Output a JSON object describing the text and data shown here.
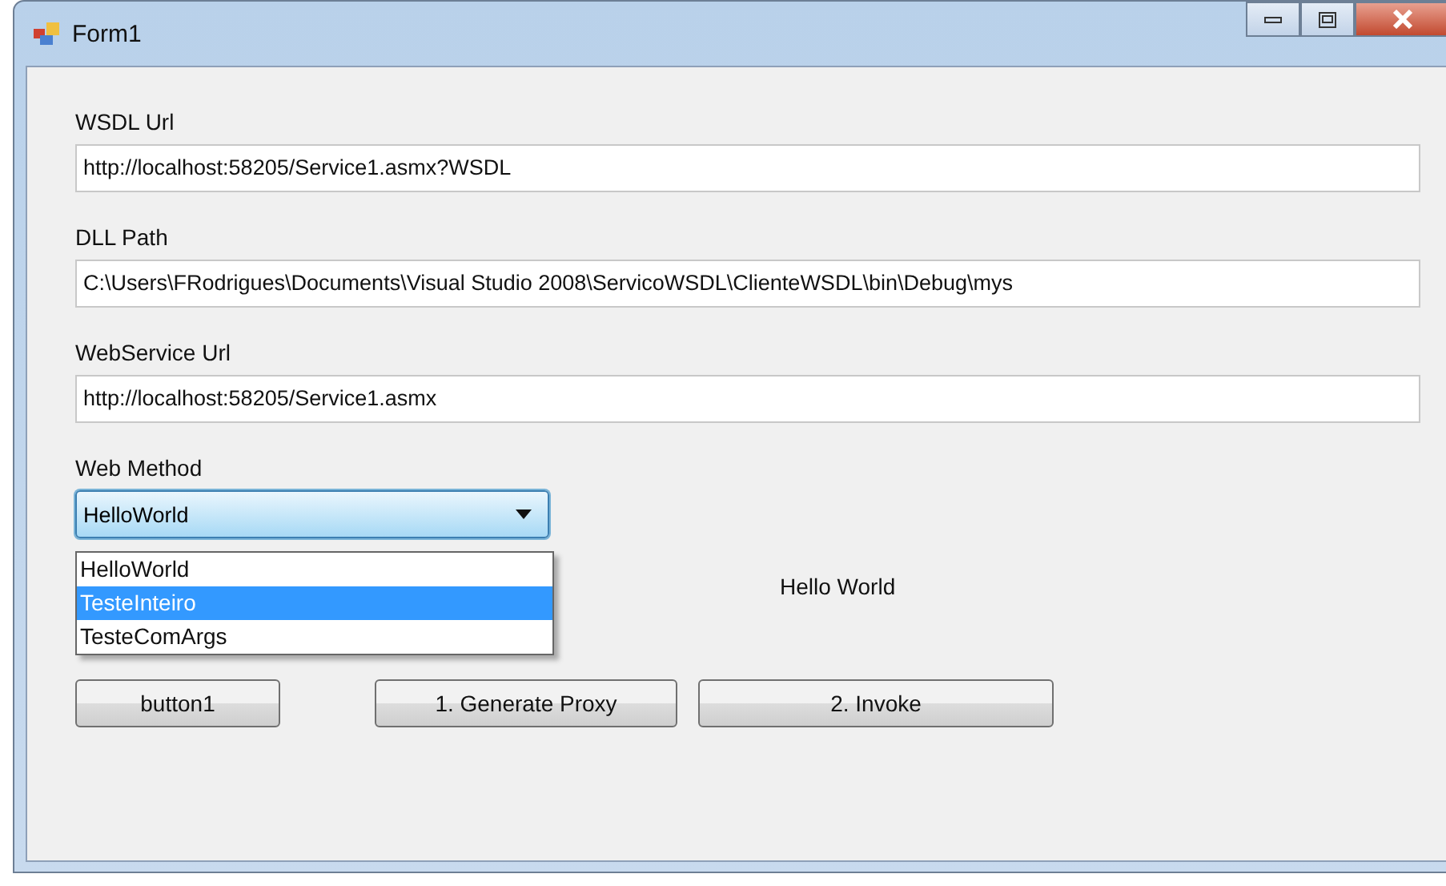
{
  "window": {
    "title": "Form1"
  },
  "fields": [
    {
      "label": "WSDL Url",
      "value": "http://localhost:58205/Service1.asmx?WSDL"
    },
    {
      "label": "DLL Path",
      "value": "C:\\Users\\FRodrigues\\Documents\\Visual Studio 2008\\ServicoWSDL\\ClienteWSDL\\bin\\Debug\\mys"
    },
    {
      "label": "WebService Url",
      "value": "http://localhost:58205/Service1.asmx"
    }
  ],
  "web_method": {
    "label": "Web Method",
    "value": "HelloWorld",
    "expanded": true,
    "options": [
      {
        "label": "HelloWorld",
        "highlighted": false
      },
      {
        "label": "TesteInteiro",
        "highlighted": true
      },
      {
        "label": "TesteComArgs",
        "highlighted": false
      }
    ]
  },
  "result": "Hello World",
  "buttons": [
    "button1",
    "1. Generate Proxy",
    "2. Invoke"
  ]
}
